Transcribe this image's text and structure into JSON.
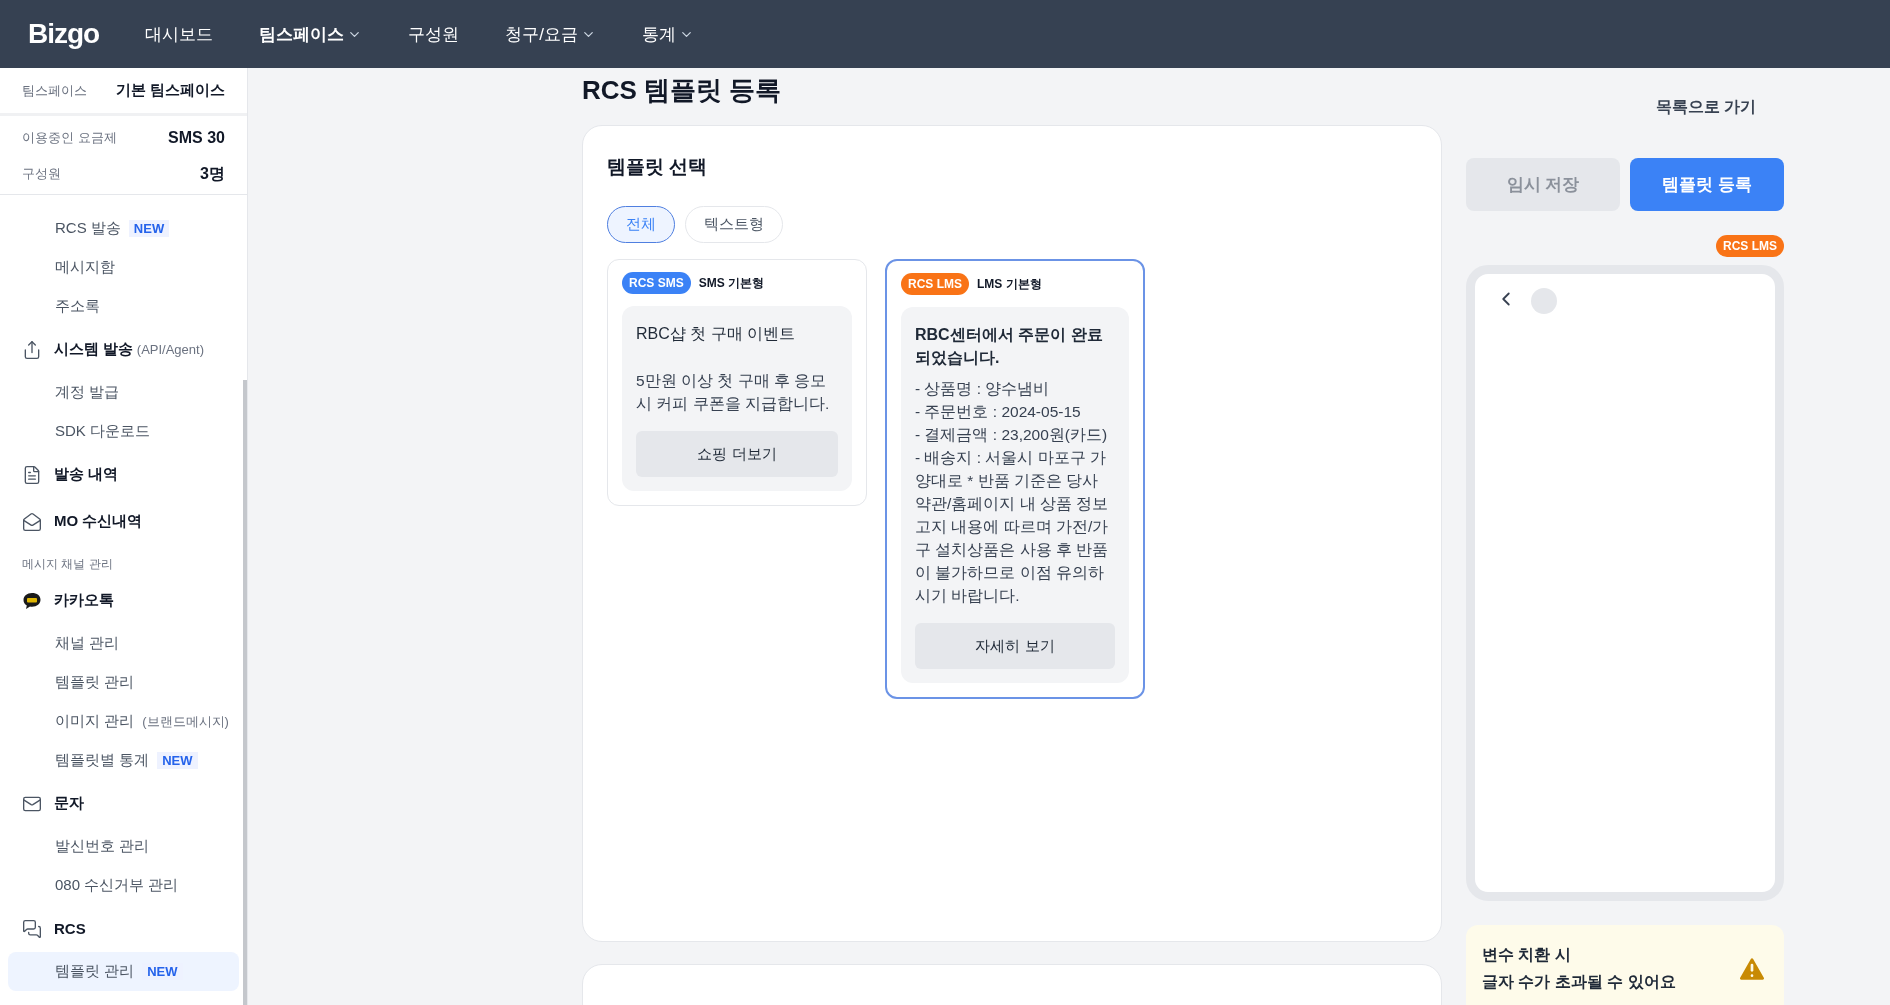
{
  "nav": {
    "logo": "Bizgo",
    "items": [
      {
        "label": "대시보드",
        "selected": false,
        "dropdown": false
      },
      {
        "label": "팀스페이스",
        "selected": true,
        "dropdown": true
      },
      {
        "label": "구성원",
        "selected": false,
        "dropdown": false
      },
      {
        "label": "청구/요금",
        "selected": false,
        "dropdown": true
      },
      {
        "label": "통계",
        "selected": false,
        "dropdown": true
      }
    ]
  },
  "sidebar": {
    "workspace": {
      "label": "팀스페이스",
      "value": "기본 팀스페이스"
    },
    "info": [
      {
        "label": "이용중인 요금제",
        "value": "SMS 30"
      },
      {
        "label": "구성원",
        "value": "3명"
      }
    ],
    "menu": [
      {
        "kind": "sub",
        "label": "RCS 발송",
        "badge": "NEW",
        "selected": false
      },
      {
        "kind": "sub",
        "label": "메시지함",
        "selected": false
      },
      {
        "kind": "sub",
        "label": "주소록",
        "selected": false
      },
      {
        "kind": "group",
        "label": "시스템 발송",
        "note": "(API/Agent)"
      },
      {
        "kind": "sub",
        "label": "계정 발급",
        "selected": false
      },
      {
        "kind": "sub",
        "label": "SDK 다운로드",
        "selected": false
      },
      {
        "kind": "group",
        "label": "발송 내역"
      },
      {
        "kind": "group",
        "label": "MO 수신내역"
      },
      {
        "kind": "section",
        "label": "메시지 채널 관리"
      },
      {
        "kind": "group",
        "label": "카카오톡"
      },
      {
        "kind": "sub",
        "label": "채널 관리",
        "selected": false
      },
      {
        "kind": "sub",
        "label": "템플릿 관리",
        "selected": false
      },
      {
        "kind": "sub",
        "label": "이미지 관리",
        "note": "(브랜드메시지)",
        "selected": false
      },
      {
        "kind": "sub",
        "label": "템플릿별 통계",
        "badge": "NEW",
        "selected": false
      },
      {
        "kind": "group",
        "label": "문자"
      },
      {
        "kind": "sub",
        "label": "발신번호 관리",
        "selected": false
      },
      {
        "kind": "sub",
        "label": "080 수신거부 관리",
        "selected": false
      },
      {
        "kind": "group",
        "label": "RCS"
      },
      {
        "kind": "sub",
        "label": "템플릿 관리",
        "badge": "NEW",
        "selected": true
      }
    ]
  },
  "page": {
    "title": "RCS 템플릿 등록",
    "back_link": "목록으로 가기"
  },
  "template_select": {
    "heading": "템플릿 선택",
    "filters": [
      {
        "label": "전체",
        "selected": true
      },
      {
        "label": "텍스트형",
        "selected": false
      }
    ],
    "templates": [
      {
        "type": "RCS SMS",
        "color": "#3b82f6",
        "name": "SMS 기본형",
        "selected": false,
        "title": "RBC샵 첫 구매 이벤트",
        "title_bold": false,
        "body": [
          "5만원 이상 첫 구매 후 응모 시 커피 쿠폰을 지급합니다."
        ],
        "button": "쇼핑 더보기"
      },
      {
        "type": "RCS LMS",
        "color": "#f97316",
        "name": "LMS 기본형",
        "selected": true,
        "title": "RBC센터에서 주문이 완료 되었습니다.",
        "title_bold": true,
        "body": [
          "- 상품명 : 양수냄비",
          "- 주문번호 : 2024-05-15",
          "- 결제금액 : 23,200원(카드)",
          "- 배송지 : 서울시 마포구 가양대로 * 반품 기준은 당사 약관/홈페이지 내 상품 정보 고지 내용에 따르며 가전/가구 설치상품은 사용 후 반품이 불가하므로 이점 유의하시기 바랍니다."
        ],
        "button": "자세히 보기"
      }
    ]
  },
  "actions": [
    {
      "label": "임시 저장",
      "disabled": true
    },
    {
      "label": "템플릿 등록",
      "disabled": false
    }
  ],
  "preview": {
    "type": "RCS LMS",
    "color": "#f97316"
  },
  "warning": {
    "lines": [
      "변수 치환 시",
      "글자 수가 초과될 수 있어요"
    ]
  }
}
